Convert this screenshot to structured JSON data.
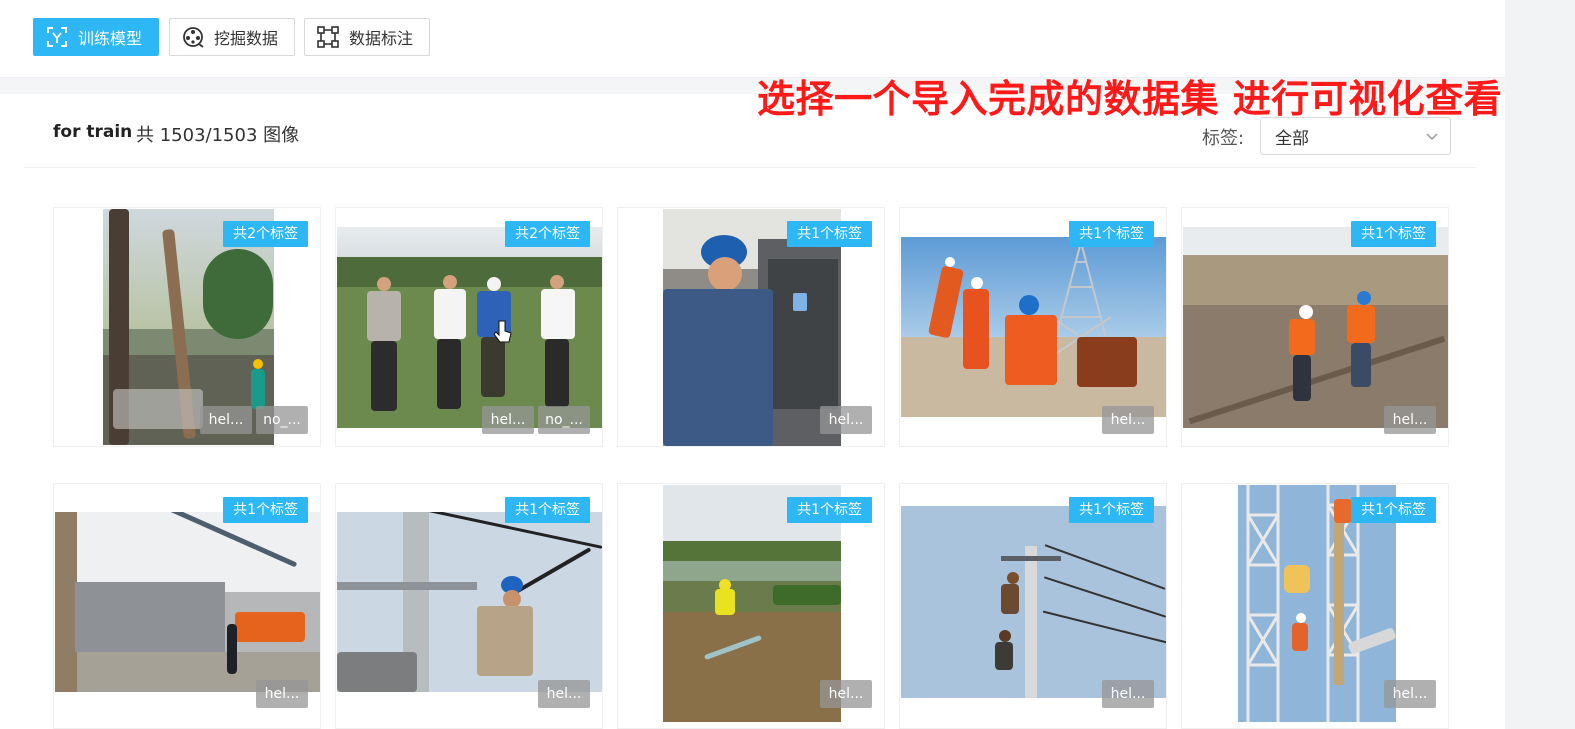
{
  "toolbar": {
    "train_label": "训练模型",
    "mine_label": "挖掘数据",
    "annotate_label": "数据标注"
  },
  "caption": "选择一个导入完成的数据集 进行可视化查看",
  "dataset": {
    "name": "for train",
    "count_text": "共 1503/1503 图像"
  },
  "filter": {
    "label": "标签:",
    "selected": "全部"
  },
  "colors": {
    "primary": "#2db7f5",
    "caption": "#ff1a1a"
  },
  "cards": [
    {
      "badge": "共2个标签",
      "chips": [
        "hel...",
        "no_..."
      ],
      "scene": "construction-ladder"
    },
    {
      "badge": "共2个标签",
      "chips": [
        "hel...",
        "no_..."
      ],
      "scene": "field-group"
    },
    {
      "badge": "共1个标签",
      "chips": [
        "hel..."
      ],
      "scene": "worker-cabinet"
    },
    {
      "badge": "共1个标签",
      "chips": [
        "hel..."
      ],
      "scene": "tower-workers"
    },
    {
      "badge": "共1个标签",
      "chips": [
        "hel..."
      ],
      "scene": "slope-workers"
    },
    {
      "badge": "共1个标签",
      "chips": [
        "hel..."
      ],
      "scene": "substation-crane"
    },
    {
      "badge": "共1个标签",
      "chips": [
        "hel..."
      ],
      "scene": "pole-worker"
    },
    {
      "badge": "共1个标签",
      "chips": [
        "hel..."
      ],
      "scene": "canal-worker"
    },
    {
      "badge": "共1个标签",
      "chips": [
        "hel..."
      ],
      "scene": "pole-climb"
    },
    {
      "badge": "共1个标签",
      "chips": [
        "hel..."
      ],
      "scene": "tower-insulator"
    }
  ]
}
